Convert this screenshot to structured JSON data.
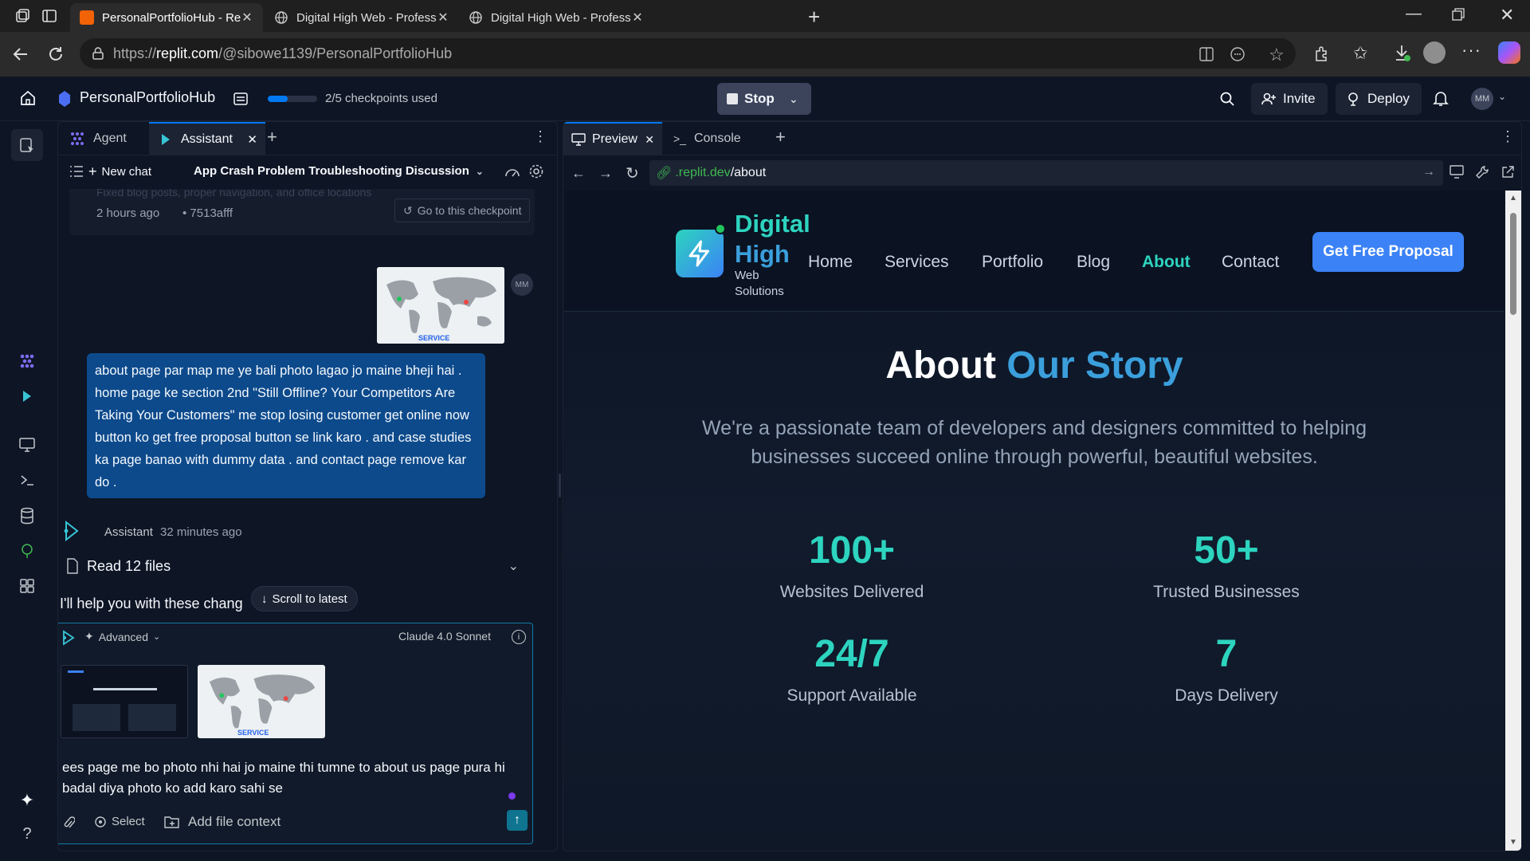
{
  "browser": {
    "tabs": [
      {
        "title": "PersonalPortfolioHub - Replit",
        "active": true
      },
      {
        "title": "Digital High Web - Professional W",
        "active": false
      },
      {
        "title": "Digital High Web - Professional W",
        "active": false
      }
    ],
    "url_prefix": "https://",
    "url_domain": "replit.com",
    "url_path": "/@sibowe1139/PersonalPortfolioHub"
  },
  "replit_header": {
    "project_name": "PersonalPortfolioHub",
    "checkpoints_text": "2/5 checkpoints used",
    "checkpoints_progress": 0.4,
    "stop_label": "Stop",
    "invite_label": "Invite",
    "deploy_label": "Deploy",
    "avatar_initials": "MM"
  },
  "chat": {
    "tabs": [
      {
        "label": "Agent"
      },
      {
        "label": "Assistant"
      }
    ],
    "new_chat_label": "New chat",
    "chat_title": "App Crash Problem Troubleshooting Discussion",
    "checkpoint_faded_text": "Fixed blog posts, proper navigation, and office locations",
    "checkpoint_time": "2 hours ago",
    "checkpoint_hash": "• 7513afff",
    "checkpoint_button": "Go to this checkpoint",
    "user_avatar": "MM",
    "user_image_caption": "SERVICE",
    "user_message": "about page par map me ye bali photo lagao jo maine bheji hai . home page ke section 2nd \"Still Offline? Your Competitors Are Taking Your Customers\" me stop losing customer get online now button ko get free proposal button se link karo . and case studies ka page banao with dummy data . and contact page remove kar do .",
    "assistant_name": "Assistant",
    "assistant_time": "32 minutes ago",
    "read_files_label": "Read 12 files",
    "assistant_reply": "I'll help you with these chang",
    "scroll_latest": "Scroll to latest",
    "composer": {
      "mode_label": "Advanced",
      "model_label": "Claude 4.0 Sonnet",
      "attachment_caption": "SERVICE",
      "text": "ees page me bo photo nhi hai jo maine  thi tumne to about us page pura hi badal diya  photo ko add karo sahi se",
      "select_label": "Select",
      "add_file_label": "Add file context"
    }
  },
  "preview": {
    "tabs": [
      {
        "label": "Preview"
      },
      {
        "label": "Console"
      }
    ],
    "url_domain": ".replit.dev",
    "url_path": "/about",
    "site": {
      "logo_line1": "Digital",
      "logo_line2": "High",
      "logo_sub1": "Web",
      "logo_sub2": "Solutions",
      "nav": [
        "Home",
        "Services",
        "Portfolio",
        "Blog",
        "About",
        "Contact"
      ],
      "active_nav": "About",
      "cta": "Get Free Proposal",
      "hero_title_white": "About",
      "hero_title_blue": "Our Story",
      "hero_sub": "We're a passionate team of developers and designers committed to helping businesses succeed online through powerful, beautiful websites.",
      "stats": [
        {
          "value": "100+",
          "label": "Websites Delivered"
        },
        {
          "value": "50+",
          "label": "Trusted Businesses"
        },
        {
          "value": "24/7",
          "label": "Support Available"
        },
        {
          "value": "7",
          "label": "Days Delivery"
        }
      ]
    }
  },
  "colors": {
    "accent_blue": "#0079f2",
    "brand_teal": "#2dd4bf",
    "brand_blue": "#3b82f6",
    "user_bubble": "#0d4a8c"
  }
}
